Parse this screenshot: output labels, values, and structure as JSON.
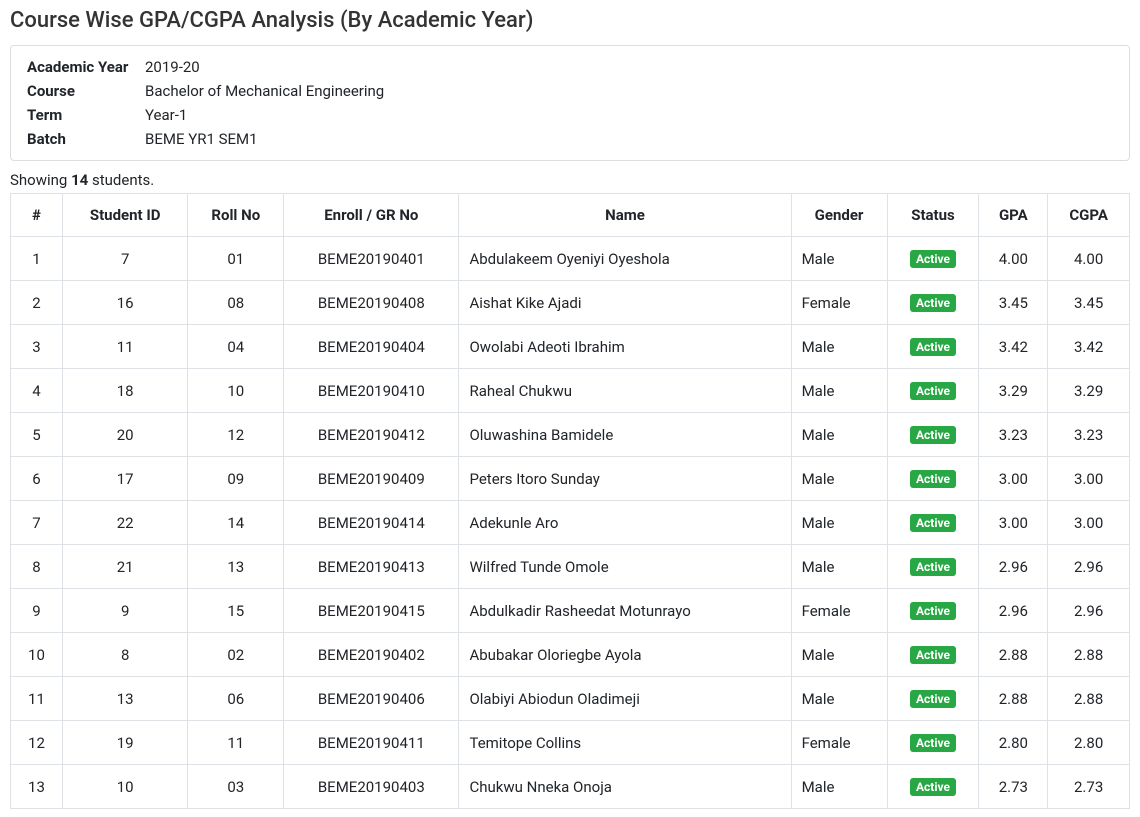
{
  "page_title": "Course Wise GPA/CGPA Analysis (By Academic Year)",
  "info": {
    "academic_year_label": "Academic Year",
    "academic_year_value": "2019-20",
    "course_label": "Course",
    "course_value": "Bachelor of Mechanical Engineering",
    "term_label": "Term",
    "term_value": "Year-1",
    "batch_label": "Batch",
    "batch_value": "BEME YR1 SEM1"
  },
  "count_prefix": "Showing ",
  "count_number": "14",
  "count_suffix": " students.",
  "headers": {
    "index": "#",
    "student_id": "Student ID",
    "roll_no": "Roll No",
    "enroll": "Enroll / GR No",
    "name": "Name",
    "gender": "Gender",
    "status": "Status",
    "gpa": "GPA",
    "cgpa": "CGPA"
  },
  "status_active": "Active",
  "rows": [
    {
      "idx": "1",
      "sid": "7",
      "roll": "01",
      "enroll": "BEME20190401",
      "name": "Abdulakeem Oyeniyi Oyeshola",
      "gender": "Male",
      "gpa": "4.00",
      "cgpa": "4.00"
    },
    {
      "idx": "2",
      "sid": "16",
      "roll": "08",
      "enroll": "BEME20190408",
      "name": "Aishat Kike Ajadi",
      "gender": "Female",
      "gpa": "3.45",
      "cgpa": "3.45"
    },
    {
      "idx": "3",
      "sid": "11",
      "roll": "04",
      "enroll": "BEME20190404",
      "name": "Owolabi Adeoti Ibrahim",
      "gender": "Male",
      "gpa": "3.42",
      "cgpa": "3.42"
    },
    {
      "idx": "4",
      "sid": "18",
      "roll": "10",
      "enroll": "BEME20190410",
      "name": "Raheal Chukwu",
      "gender": "Male",
      "gpa": "3.29",
      "cgpa": "3.29"
    },
    {
      "idx": "5",
      "sid": "20",
      "roll": "12",
      "enroll": "BEME20190412",
      "name": "Oluwashina Bamidele",
      "gender": "Male",
      "gpa": "3.23",
      "cgpa": "3.23"
    },
    {
      "idx": "6",
      "sid": "17",
      "roll": "09",
      "enroll": "BEME20190409",
      "name": "Peters Itoro Sunday",
      "gender": "Male",
      "gpa": "3.00",
      "cgpa": "3.00"
    },
    {
      "idx": "7",
      "sid": "22",
      "roll": "14",
      "enroll": "BEME20190414",
      "name": "Adekunle Aro",
      "gender": "Male",
      "gpa": "3.00",
      "cgpa": "3.00"
    },
    {
      "idx": "8",
      "sid": "21",
      "roll": "13",
      "enroll": "BEME20190413",
      "name": "Wilfred Tunde Omole",
      "gender": "Male",
      "gpa": "2.96",
      "cgpa": "2.96"
    },
    {
      "idx": "9",
      "sid": "9",
      "roll": "15",
      "enroll": "BEME20190415",
      "name": "Abdulkadir Rasheedat Motunrayo",
      "gender": "Female",
      "gpa": "2.96",
      "cgpa": "2.96"
    },
    {
      "idx": "10",
      "sid": "8",
      "roll": "02",
      "enroll": "BEME20190402",
      "name": "Abubakar Oloriegbe Ayola",
      "gender": "Male",
      "gpa": "2.88",
      "cgpa": "2.88"
    },
    {
      "idx": "11",
      "sid": "13",
      "roll": "06",
      "enroll": "BEME20190406",
      "name": "Olabiyi Abiodun Oladimeji",
      "gender": "Male",
      "gpa": "2.88",
      "cgpa": "2.88"
    },
    {
      "idx": "12",
      "sid": "19",
      "roll": "11",
      "enroll": "BEME20190411",
      "name": "Temitope Collins",
      "gender": "Female",
      "gpa": "2.80",
      "cgpa": "2.80"
    },
    {
      "idx": "13",
      "sid": "10",
      "roll": "03",
      "enroll": "BEME20190403",
      "name": "Chukwu Nneka Onoja",
      "gender": "Male",
      "gpa": "2.73",
      "cgpa": "2.73"
    }
  ]
}
